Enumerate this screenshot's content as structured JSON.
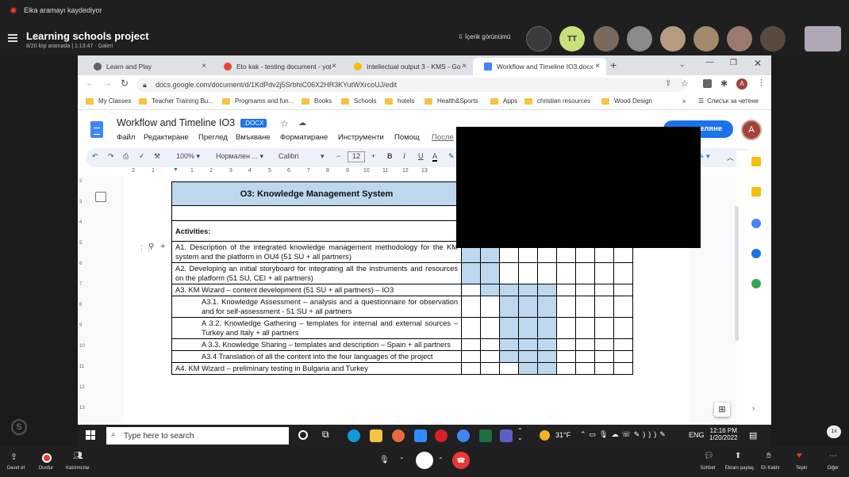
{
  "teams": {
    "recording": "Elka aramayı kaydediyor",
    "meeting_title": "Learning schools project",
    "meeting_sub": "8/20 kişi aramada | 1:13:47",
    "gallery": "Galeri",
    "content_view": "İçerik görünümü",
    "avatar_tt": "TT",
    "bottom": {
      "invite": "Davet et",
      "stop": "Durdur",
      "participants": "Katılımcılar",
      "chat": "Sohbet",
      "share": "Ekranı paylaş",
      "raise": "Eli Kaldır",
      "react": "Tepki",
      "more": "Diğer"
    },
    "speed": "1x"
  },
  "browser": {
    "tabs": [
      {
        "label": "Learn and Play",
        "color": "#5f6368"
      },
      {
        "label": "Eto kak - testing document - yot",
        "color": "#ea4335"
      },
      {
        "label": "Intellectual output 3 - KMS - Go",
        "color": "#fbbc04"
      },
      {
        "label": "Workflow and Timeline IO3.docx",
        "color": "#4285f4"
      }
    ],
    "url": "docs.google.com/document/d/1KdPdv2j5SrbhiC06X2HR3KYutWXrcoUJ/edit",
    "bookmarks": [
      "My Classes",
      "Teacher Training Bu...",
      "Progmams and fun...",
      "Books",
      "Schools",
      "hotels",
      "Health&Sports",
      "Apps",
      "christian resources",
      "Wood Design"
    ],
    "reading_list": "Списък за четене"
  },
  "docs": {
    "title": "Workflow and Timeline IO3",
    "ext": ".DOCX",
    "menus": [
      "Файл",
      "Редактиране",
      "Преглед",
      "Вмъкване",
      "Форматиране",
      "Инструменти",
      "Помощ",
      "После"
    ],
    "share": "деляне",
    "avatar": "A",
    "toolbar": {
      "zoom": "100%",
      "style": "Нормален ...",
      "font": "Calibri",
      "size": "12"
    },
    "ruler": [
      "2",
      "1",
      "1",
      "2",
      "3",
      "4",
      "5",
      "6",
      "7",
      "8",
      "9",
      "10",
      "11",
      "12",
      "13"
    ],
    "vruler": [
      "2",
      "3",
      "4",
      "5",
      "6",
      "7",
      "8",
      "9",
      "10",
      "11",
      "12",
      "13"
    ]
  },
  "table": {
    "title": "O3: Knowledge Management System",
    "activities": "Activities:",
    "rows": [
      {
        "text": "A1. Description of the integrated knowledge management methodology for the KM system and the platform in OU4 (51 SU + all partners)",
        "indent": false,
        "blue": [
          0,
          1
        ]
      },
      {
        "text": "A2. Developing an initial storyboard for integrating all the instruments and resources on the platform (51 SU, CEI + all partners)",
        "indent": false,
        "blue": [
          0,
          1
        ]
      },
      {
        "text": "A3. KM Wizard – content development (51 SU + all partners) – IO3",
        "indent": false,
        "blue": [
          1,
          2,
          3,
          4
        ]
      },
      {
        "text": "A3.1. Knowledge Assessment – analysis and a questionnaire for observation and for self-assessment - 51 SU + all partners",
        "indent": true,
        "blue": [
          2,
          3,
          4
        ]
      },
      {
        "text": "A 3.2. Knowledge Gathering – templates for internal and external sources – Turkey and Italy + all partners",
        "indent": true,
        "blue": [
          2,
          3,
          4
        ]
      },
      {
        "text": "A 3.3. Knowledge Sharing – templates and description – Spain + all partners",
        "indent": true,
        "blue": [
          2,
          3,
          4
        ]
      },
      {
        "text": "A3.4 Translation of all the content into the four languages of the project",
        "indent": true,
        "blue": [
          2,
          3,
          4
        ]
      },
      {
        "text": "A4. KM Wizard – preliminary testing in Bulgaria and Turkey",
        "indent": false,
        "blue": [
          3,
          4
        ]
      }
    ]
  },
  "taskbar": {
    "search": "Type here to search",
    "temp": "31°F",
    "lang": "ENG",
    "time": "12:16 PM",
    "date": "1/20/2022"
  }
}
